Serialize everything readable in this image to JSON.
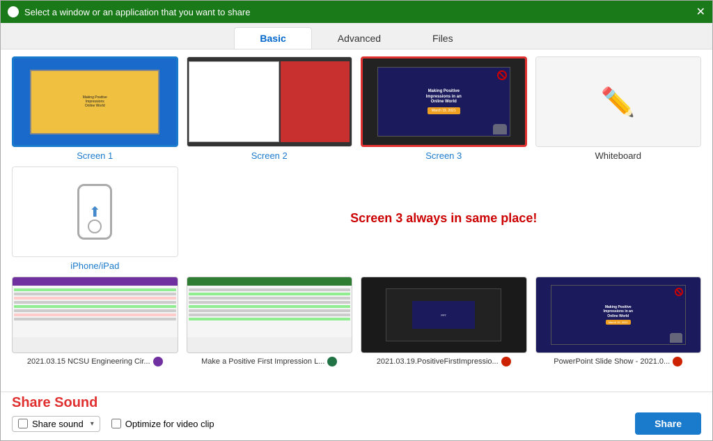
{
  "titlebar": {
    "title": "Select a window or an application that you want to share",
    "close_label": "✕"
  },
  "tabs": [
    {
      "id": "basic",
      "label": "Basic",
      "active": true
    },
    {
      "id": "advanced",
      "label": "Advanced",
      "active": false
    },
    {
      "id": "files",
      "label": "Files",
      "active": false
    }
  ],
  "screens": [
    {
      "id": "screen1",
      "label": "Screen 1",
      "selected": false,
      "highlighted": true
    },
    {
      "id": "screen2",
      "label": "Screen 2",
      "selected": false,
      "highlighted": false
    },
    {
      "id": "screen3",
      "label": "Screen 3",
      "selected": true,
      "highlighted": false
    },
    {
      "id": "whiteboard",
      "label": "Whiteboard",
      "selected": false,
      "highlighted": false
    }
  ],
  "annotation": "Screen 3 always in same place!",
  "iphone": {
    "label": "iPhone/iPad"
  },
  "apps": [
    {
      "id": "app1",
      "label": "2021.03.15 NCSU Engineering Cir...N",
      "badge_color": "#7030a0",
      "header_color": "#7030a0"
    },
    {
      "id": "app2",
      "label": "Make a Positive First Impression L...X",
      "badge_color": "#217346",
      "header_color": "#2e7d32"
    },
    {
      "id": "app3",
      "label": "2021.03.19.PositiveFirstImpressio...P",
      "badge_color": "#cc2200",
      "header_color": "#cc4400"
    },
    {
      "id": "app4",
      "label": "PowerPoint Slide Show  -  2021.0...P",
      "badge_color": "#cc2200",
      "header_color": "#1a1a5c"
    }
  ],
  "bottombar": {
    "share_sound_title": "Share Sound",
    "share_sound_label": "Share sound",
    "optimize_label": "Optimize for video clip",
    "share_button_label": "Share"
  }
}
